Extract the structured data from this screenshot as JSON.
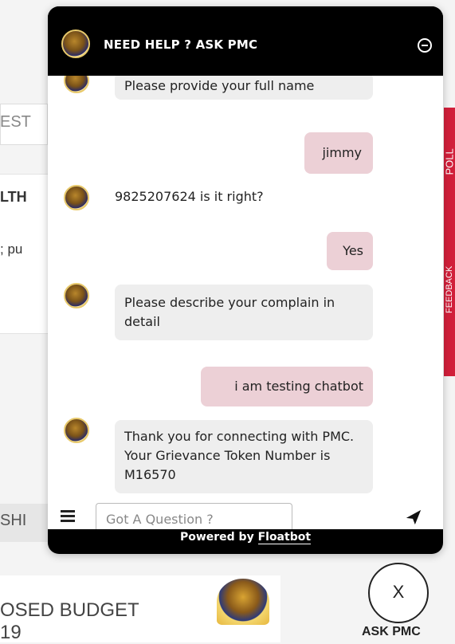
{
  "background_page": {
    "fragment_rest": "EST",
    "fragment_lth": "LTH",
    "fragment_pu": "; pu",
    "fragment_shi": "SHI",
    "fragment_budget": "OSED BUDGET",
    "fragment_year": "19",
    "side_tab_top": "POLL",
    "side_tab_bottom": "FEEDBACK"
  },
  "chat_widget": {
    "title": "NEED HELP ? ASK PMC",
    "messages": [
      {
        "sender": "bot",
        "text": "Please provide your full name"
      },
      {
        "sender": "user",
        "text": "jimmy"
      },
      {
        "sender": "bot",
        "text": "9825207624 is it right?"
      },
      {
        "sender": "user",
        "text": "Yes"
      },
      {
        "sender": "bot",
        "text": "Please describe your complain in detail"
      },
      {
        "sender": "user",
        "text": "i am testing chatbot"
      },
      {
        "sender": "bot",
        "text": "Thank you for connecting with PMC. Your Grievance Token Number is M16570"
      }
    ],
    "input_placeholder": "Got A Question ?",
    "powered_prefix": "Powered by",
    "powered_brand": "Floatbot"
  },
  "launcher": {
    "close_glyph": "X",
    "label": "ASK PMC"
  },
  "colors": {
    "user_bubble": "#ecd0d6",
    "bot_bubble": "#eeeeee",
    "header": "#000000",
    "side_tab": "#d11f3a"
  },
  "icons": [
    "pmc-logo-icon",
    "minimize-icon",
    "menu-icon",
    "send-icon",
    "close-icon"
  ]
}
